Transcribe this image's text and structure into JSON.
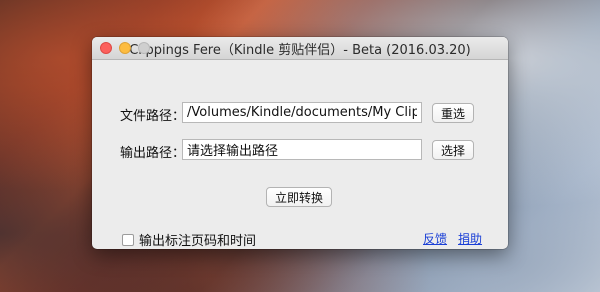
{
  "window": {
    "title": "Clippings Fere（Kindle 剪贴伴侣）- Beta (2016.03.20)"
  },
  "file_path": {
    "label": "文件路径：",
    "value": "/Volumes/Kindle/documents/My Clippings.txt",
    "button_label": "重选"
  },
  "output_path": {
    "label": "输出路径：",
    "value": "请选择输出路径",
    "button_label": "选择"
  },
  "convert_button_label": "立即转换",
  "options": {
    "include_page_time_label": "输出标注页码和时间",
    "include_page_time_checked": false
  },
  "links": {
    "feedback": "反馈",
    "donate": "捐助"
  },
  "colors": {
    "link": "#1a3fd6",
    "close": "#fc605c",
    "minimize": "#fdbc40"
  }
}
